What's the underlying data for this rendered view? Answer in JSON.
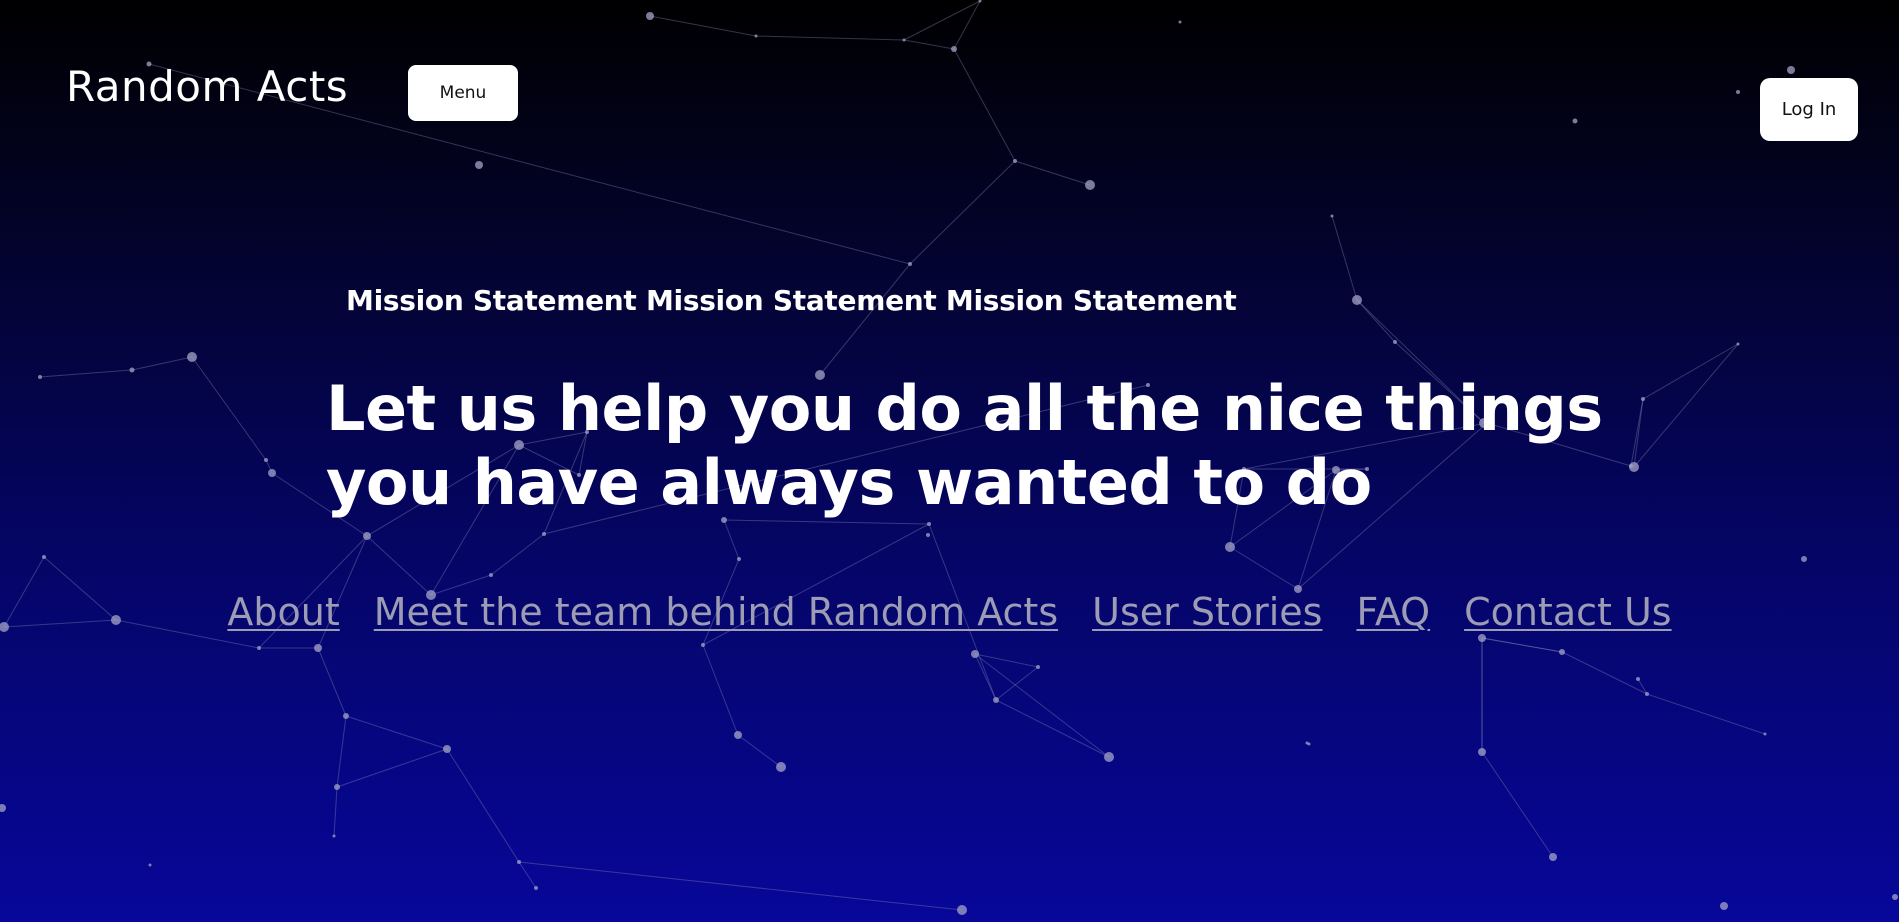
{
  "header": {
    "brand": "Random Acts",
    "menu_label": "Menu",
    "login_label": "Log In"
  },
  "hero": {
    "mission": "Mission Statement Mission Statement Mission Statement",
    "headline": "Let us help you do all the nice things you have always wanted to do"
  },
  "nav": {
    "links": [
      {
        "label": "About"
      },
      {
        "label": "Meet the team behind Random Acts"
      },
      {
        "label": "User Stories"
      },
      {
        "label": "FAQ"
      },
      {
        "label": "Contact Us"
      }
    ]
  },
  "colors": {
    "background_top": "#000000",
    "background_bottom": "#07079a",
    "text": "#ffffff",
    "link": "#9c9cb4",
    "button_bg": "#ffffff"
  }
}
